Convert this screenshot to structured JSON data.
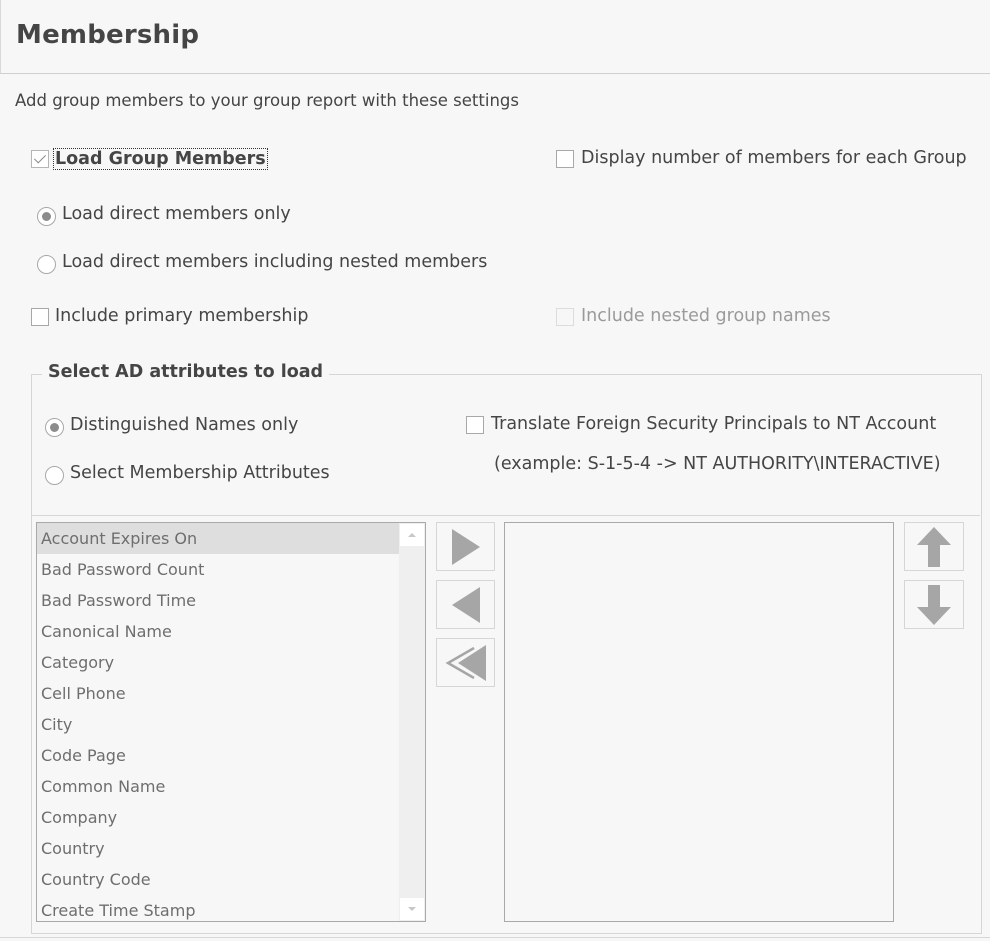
{
  "header": {
    "title": "Membership"
  },
  "subtitle": "Add group members to your group report with these settings",
  "options": {
    "load_group_members": {
      "label": "Load Group Members",
      "checked": true
    },
    "display_member_count": {
      "label": "Display number of members for each Group",
      "checked": false
    },
    "load_mode": {
      "selected": "direct_only",
      "options": [
        {
          "id": "direct_only",
          "label": "Load direct members only"
        },
        {
          "id": "nested",
          "label": "Load direct members including nested members"
        }
      ]
    },
    "include_primary_membership": {
      "label": "Include primary membership",
      "checked": false
    },
    "include_nested_group_names": {
      "label": "Include nested group names",
      "checked": false,
      "disabled": true
    }
  },
  "ad_attributes": {
    "title": "Select AD attributes to load",
    "mode": {
      "selected": "dn_only",
      "options": [
        {
          "id": "dn_only",
          "label": "Distinguished Names only"
        },
        {
          "id": "select_attributes",
          "label": "Select Membership Attributes"
        }
      ]
    },
    "translate_fsp": {
      "label": "Translate Foreign Security Principals to NT Account",
      "example": "(example: S-1-5-4 -> NT AUTHORITY\\INTERACTIVE)",
      "checked": false
    },
    "available_attributes": [
      "Account Expires On",
      "Bad Password Count",
      "Bad Password Time",
      "Canonical Name",
      "Category",
      "Cell Phone",
      "City",
      "Code Page",
      "Common Name",
      "Company",
      "Country",
      "Country Code",
      "Create Time Stamp"
    ],
    "selected_index": 0,
    "selected_attributes": [],
    "buttons": {
      "add": "add-arrow-right",
      "remove": "remove-arrow-left",
      "remove_all": "remove-all-double-arrow-left",
      "move_up": "move-up-arrow",
      "move_down": "move-down-arrow"
    }
  },
  "colors": {
    "background": "#f7f7f7",
    "text": "#454545",
    "disabled_text": "#9a9a9a",
    "list_text": "#6e6e6e",
    "selection": "#dedede",
    "icon_gray": "#a6a6a6",
    "border": "#d6d6d6"
  }
}
